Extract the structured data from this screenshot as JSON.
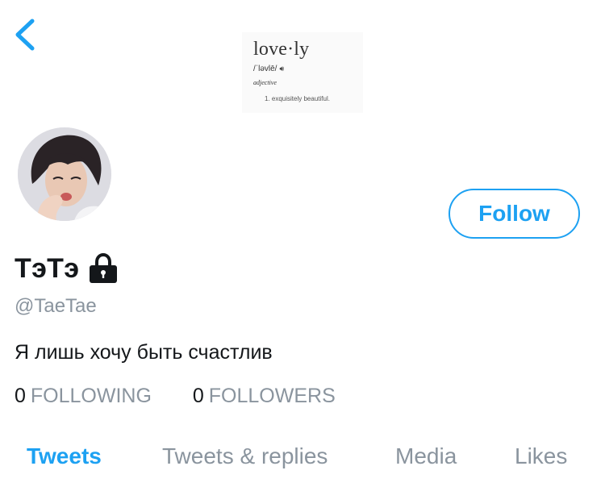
{
  "colors": {
    "accent": "#1da1f2",
    "text_primary": "#14171a",
    "text_secondary": "#8a949e"
  },
  "header": {
    "back_icon": "chevron-left-icon",
    "banner_definition": {
      "word": "love·ly",
      "pronunciation": "/ˈləvlē/",
      "part_of_speech": "adjective",
      "sense_number": "1.",
      "sense_text": "exquisitely beautiful."
    }
  },
  "profile": {
    "avatar": "avatar-photo",
    "display_name": "ТэТэ",
    "lock_icon": "lock-icon",
    "handle": "@TaeTae",
    "bio": "Я лишь хочу быть счастлив",
    "follow_label": "Follow",
    "following_count": "0",
    "following_label": "FOLLOWING",
    "followers_count": "0",
    "followers_label": "FOLLOWERS"
  },
  "tabs": [
    {
      "label": "Tweets",
      "active": true
    },
    {
      "label": "Tweets & replies",
      "active": false
    },
    {
      "label": "Media",
      "active": false
    },
    {
      "label": "Likes",
      "active": false
    }
  ]
}
